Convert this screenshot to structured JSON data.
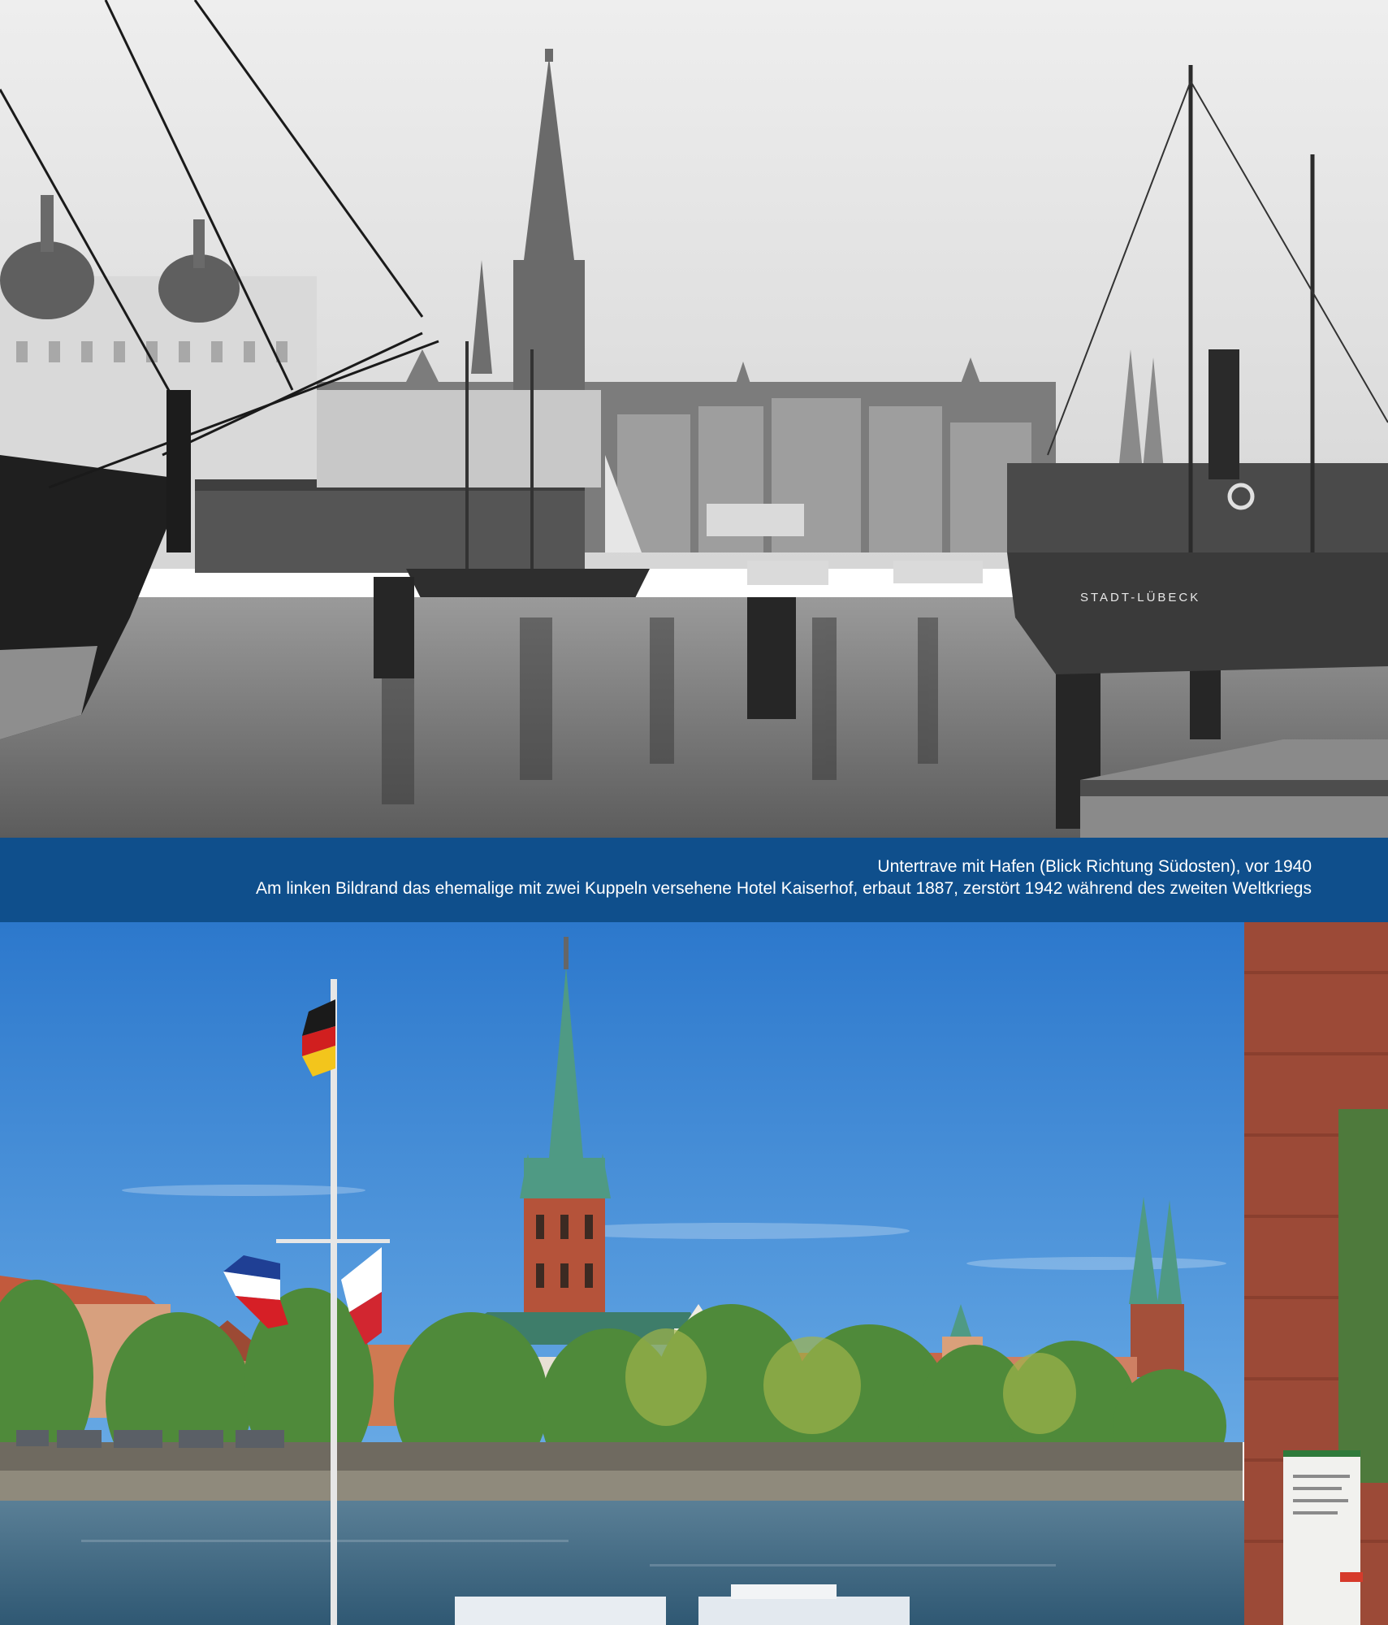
{
  "caption": {
    "line1": "Untertrave mit Hafen (Blick Richtung Südosten), vor 1940",
    "line2": "Am linken Bildrand das ehemalige mit zwei Kuppeln versehene Hotel Kaiserhof, erbaut 1887, zerstört 1942 während des zweiten Weltkriegs"
  },
  "ship_name": "STADT-LÜBECK",
  "colors": {
    "caption_band": "#0f4f8c",
    "caption_text": "#ffffff",
    "sky_modern": "#2f7fd0",
    "water_modern": "#3a6a8a"
  }
}
